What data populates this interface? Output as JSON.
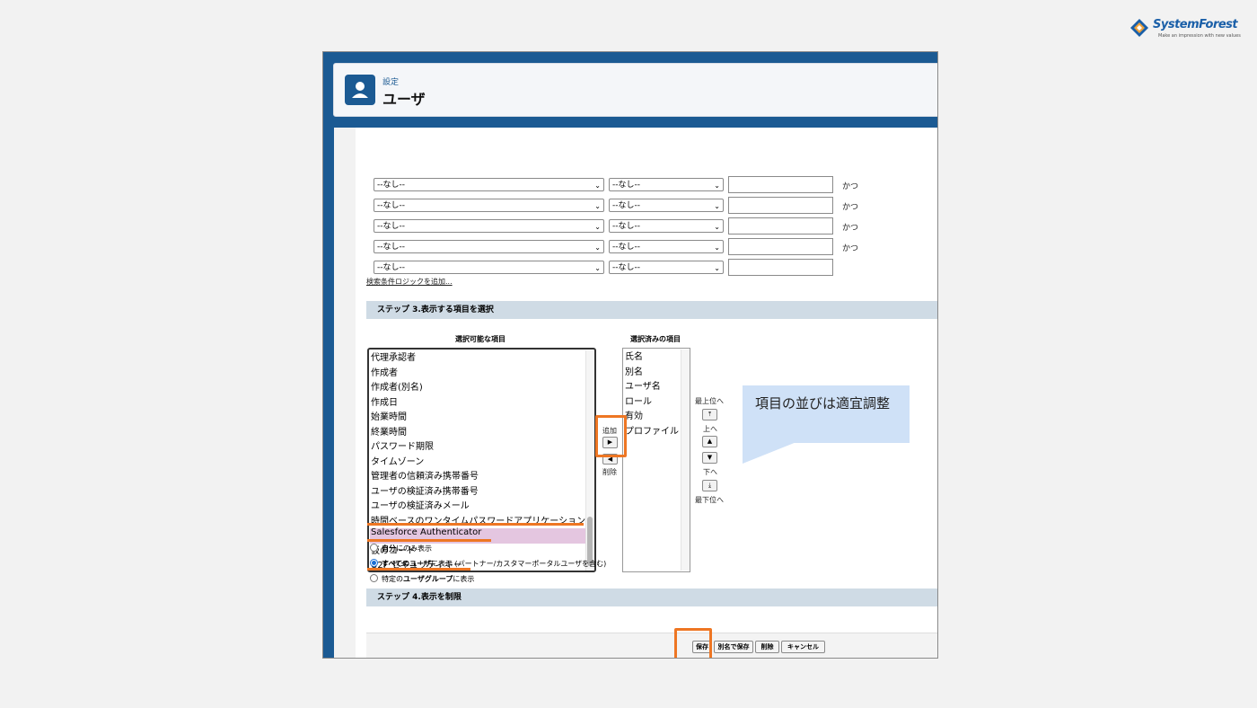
{
  "brand": {
    "name": "SystemForest",
    "tagline": "Make an impression with new values"
  },
  "header": {
    "breadcrumb": "設定",
    "title": "ユーザ"
  },
  "filters": {
    "rows": [
      {
        "field": "--なし--",
        "operator": "--なし--",
        "value": "",
        "conjunction": "かつ"
      },
      {
        "field": "--なし--",
        "operator": "--なし--",
        "value": "",
        "conjunction": "かつ"
      },
      {
        "field": "--なし--",
        "operator": "--なし--",
        "value": "",
        "conjunction": "かつ"
      },
      {
        "field": "--なし--",
        "operator": "--なし--",
        "value": "",
        "conjunction": "かつ"
      },
      {
        "field": "--なし--",
        "operator": "--なし--",
        "value": "",
        "conjunction": ""
      }
    ],
    "add_logic_link": "検索条件ロジックを追加..."
  },
  "step3": {
    "title": "ステップ 3.表示する項目を選択",
    "available_label": "選択可能な項目",
    "selected_label": "選択済みの項目",
    "available_items": [
      "代理承認者",
      "作成者",
      "作成者(別名)",
      "作成日",
      "始業時間",
      "終業時間",
      "パスワード期限",
      "タイムゾーン",
      "管理者の信頼済み携帯番号",
      "ユーザの検証済み携帯番号",
      "ユーザの検証済みメール",
      "時間ベースのワンタイムパスワードアプリケーション",
      "Salesforce Authenticator",
      "仮のコード",
      "U2F セキュリティキー"
    ],
    "highlighted_item": "Salesforce Authenticator",
    "selected_items": [
      "氏名",
      "別名",
      "ユーザ名",
      "ロール",
      "有効",
      "プロファイル"
    ],
    "add_label": "追加",
    "remove_label": "削除",
    "top_label": "最上位へ",
    "up_label": "上へ",
    "down_label": "下へ",
    "bottom_label": "最下位へ"
  },
  "callout": {
    "text": "項目の並びは適宜調整"
  },
  "step4": {
    "title": "ステップ 4.表示を制限",
    "options": [
      {
        "bold": "自分",
        "rest": "にのみ表示",
        "checked": false
      },
      {
        "bold": "すべてのユーザ",
        "rest": "に表示 (パートナー/カスタマーポータルユーザを含む)",
        "checked": true
      },
      {
        "pre": "特定の",
        "bold": "ユーザグループ",
        "rest": "に表示",
        "checked": false
      }
    ]
  },
  "footer": {
    "save": "保存",
    "save_as": "別名で保存",
    "delete": "削除",
    "cancel": "キャンセル"
  },
  "colors": {
    "accent": "#ee7623",
    "brand": "#1b5a93",
    "highlight": "#e4c6e0",
    "callout": "#cfe1f7"
  }
}
